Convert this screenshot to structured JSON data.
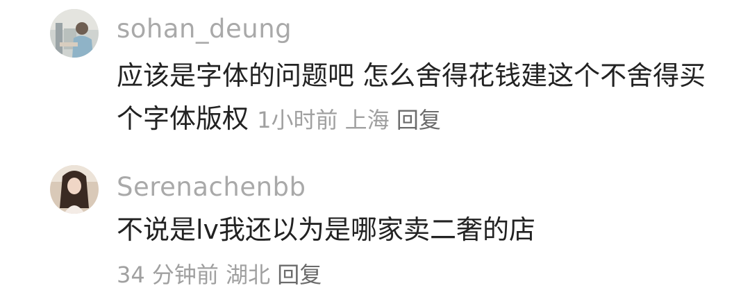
{
  "comments": [
    {
      "username": "sohan_deung",
      "text": "应该是字体的问题吧 怎么舍得花钱建这个不舍得买个字体版权",
      "time": "1小时前",
      "location": "上海",
      "reply_label": "回复"
    },
    {
      "username": "Serenachenbb",
      "text": "不说是lv我还以为是哪家卖二奢的店",
      "time": "34 分钟前",
      "location": "湖北",
      "reply_label": "回复"
    }
  ]
}
